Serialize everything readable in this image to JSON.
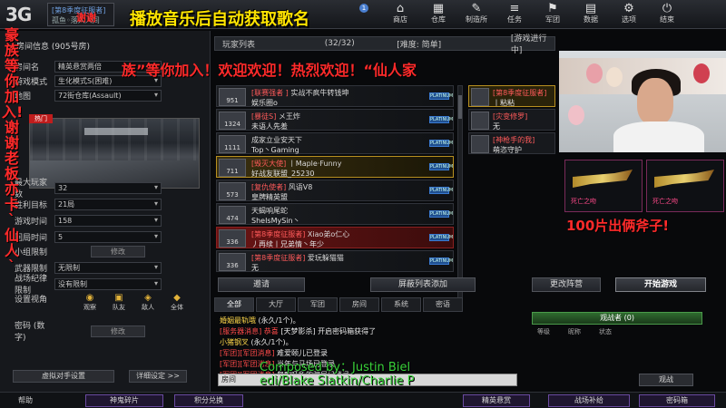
{
  "topbar": {
    "logo": "3G",
    "room_line1": "[第8季度征服者]",
    "room_line2": "孤鱼◦落入人间",
    "overlay_red": "谢谢",
    "overlay_title": "播放音乐后自动获取歌名",
    "bell_count": "1",
    "nav": [
      {
        "icon": "⌂",
        "label": "商店"
      },
      {
        "icon": "▦",
        "label": "仓库"
      },
      {
        "icon": "✎",
        "label": "制造所"
      },
      {
        "icon": "≡",
        "label": "任务"
      },
      {
        "icon": "⚑",
        "label": "军团"
      },
      {
        "icon": "▤",
        "label": "数据"
      },
      {
        "icon": "⚙",
        "label": "选项"
      },
      {
        "icon": "⏻",
        "label": "结束"
      }
    ]
  },
  "left": {
    "room_header": "房间信息 (905号房)",
    "vertical_overlay": "豪族等你加入!谢谢老板亦卡`仙人`",
    "rows_top": [
      {
        "label": "房间名",
        "value": "精英悬赏两倍"
      },
      {
        "label": "游戏模式",
        "value": "生化模式S(困难)"
      },
      {
        "label": "地图",
        "value": "72街仓库(Assault)"
      }
    ],
    "hot_tag": "热门",
    "rows_settings": [
      {
        "label": "最大玩家数",
        "value": "32"
      },
      {
        "label": "胜利目标",
        "value": "21局"
      },
      {
        "label": "游戏时间",
        "value": "158"
      },
      {
        "label": "回局时间",
        "value": "5"
      }
    ],
    "group_limit": {
      "label": "小组限制",
      "button": "修改"
    },
    "weapon_limit": {
      "label": "武器限制",
      "value": "无限制"
    },
    "discipline": {
      "label": "战场纪律限制",
      "value": "没有限制"
    },
    "view_label": "设置视角",
    "view_icons": [
      "观察",
      "队友",
      "敌人",
      "全体"
    ],
    "password": {
      "label": "密码 (数字)",
      "button": "修改"
    },
    "bottom_buttons": {
      "vs": "虚拟对手设置",
      "detail": "详细设定 >>"
    },
    "help": "帮助"
  },
  "center": {
    "list_title": "玩家列表",
    "count": "(32/32)",
    "difficulty": "[难度: 简单]",
    "status": "[游戏进行中]",
    "marquee": "族”等你加入！欢迎欢迎！热烈欢迎！“仙人家",
    "players": [
      {
        "level": "951",
        "clan": "[联赛强者 ]",
        "title": "实战不疯牛转钱坤",
        "name": "娱乐圈o",
        "style": ""
      },
      {
        "level": "1324",
        "clan": "[暴徒S]",
        "title": "メ王炸",
        "name": "未语人先羞",
        "style": ""
      },
      {
        "level": "1111",
        "clan": "",
        "title": "成家立业安天下",
        "name": "Top丶Gaming",
        "style": ""
      },
      {
        "level": "711",
        "clan": "[毁灭大使]",
        "title": "丨Maple·Funny",
        "name": "好战友联盟_25230",
        "style": "gold"
      },
      {
        "level": "573",
        "clan": "[复仇使者]",
        "title": "风语V8",
        "name": "皇牌精英盟",
        "style": ""
      },
      {
        "level": "474",
        "clan": "",
        "title": "天蝎响尾蛇",
        "name": "SheIsMySin丶",
        "style": ""
      },
      {
        "level": "336",
        "clan": "[第8季度征服者]",
        "title": "Xiao弟o仁心",
        "name": "丿再续丨兄弟情丶年少",
        "style": "red"
      },
      {
        "level": "336",
        "clan": "[第8季度征服者]",
        "title": "爱玩躲猫猫",
        "name": "无",
        "style": ""
      }
    ],
    "rank_tag": "PLATINUM",
    "right_players": [
      {
        "clan": "[第8季度征服者]",
        "name": "丨粘粘"
      },
      {
        "clan": "[灾变修罗]",
        "name": "无"
      },
      {
        "clan": "[神枪手的我]",
        "name": "萌恣守护"
      }
    ],
    "buttons": {
      "invite": "邀请",
      "block": "屏蔽列表添加",
      "change_team": "更改阵营",
      "start": "开始游戏"
    }
  },
  "stream": {
    "axe_overlay": "100片出俩斧子!",
    "card1_caption": "死亡之吻",
    "card2_caption": "死亡之吻"
  },
  "chat": {
    "tabs": [
      "全部",
      "大厅",
      "军团",
      "房间",
      "系统",
      "密语"
    ],
    "lines": [
      {
        "a": "婚姻最轨哦",
        "b": "(永久/1个)。",
        "a_color": "y"
      },
      {
        "a": "[服务器消息] 恭喜",
        "b": "[天梦影杀] 开启密码箱获得了",
        "a_color": "r"
      },
      {
        "a": "小猪钢叉",
        "b": "(永久/1个)。",
        "a_color": "y"
      },
      {
        "a": "[军团][军团消息]",
        "b": "难爱颐儿已登录",
        "a_color": "r"
      },
      {
        "a": "[军团][军团消息]",
        "b": "当年与马场已登录",
        "a_color": "r"
      },
      {
        "a": "[军团][军团消息]",
        "b": "曾梦旺所的骗局已登录",
        "a_color": "r"
      }
    ],
    "input_placeholder": "房间"
  },
  "credits": {
    "line1": "Composed by：Justin Biel",
    "line2": "edi/Blake Slatkin/Charlie P"
  },
  "observers": {
    "title": "观战者 (0)",
    "cols": [
      "等级",
      "昵称",
      "状态"
    ],
    "button": "观战"
  },
  "bottombar": {
    "items": [
      "神鬼碎片",
      "积分兑换",
      "精英悬赏",
      "战场补给",
      "密码箱"
    ]
  },
  "colors": {
    "accent_red": "#ff2a2a",
    "title_yellow": "#ffe400",
    "credit_green": "#39d23a"
  }
}
